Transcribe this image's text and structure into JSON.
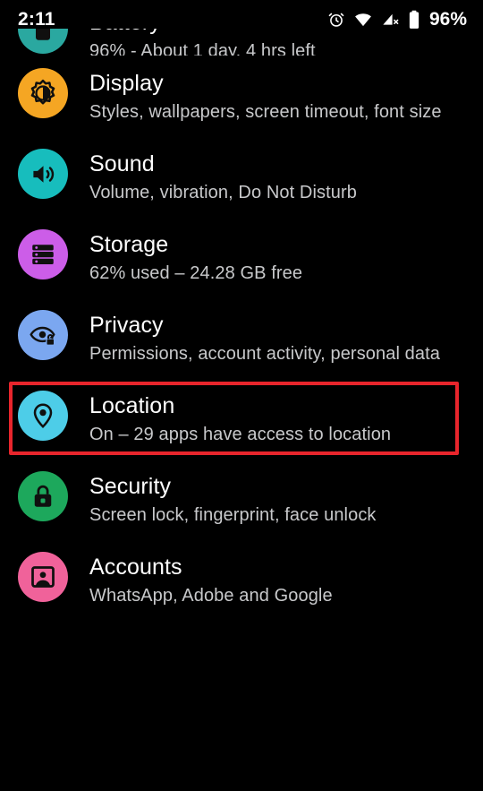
{
  "statusbar": {
    "time": "2:11",
    "battery_percent": "96%",
    "icons": [
      {
        "name": "alarm-icon",
        "label": "alarm"
      },
      {
        "name": "wifi-icon",
        "label": "wifi"
      },
      {
        "name": "mobile-signal-off-icon",
        "label": "no mobile signal"
      },
      {
        "name": "battery-icon",
        "label": "battery"
      }
    ]
  },
  "colors": {
    "background": "#000000",
    "title_text": "#ffffff",
    "summary_text": "#c8c9cb",
    "highlight_border": "#e8252c",
    "battery_icon_bg": "#2aa8a0",
    "display_icon_bg": "#f5a623",
    "sound_icon_bg": "#17bdbd",
    "storage_icon_bg": "#cc5de8",
    "privacy_icon_bg": "#7ba7f0",
    "location_icon_bg": "#4dcde8",
    "security_icon_bg": "#1da85c",
    "accounts_icon_bg": "#f0629a",
    "icon_glyph": "#10100f"
  },
  "settings": {
    "items": [
      {
        "key": "battery",
        "title": "Battery",
        "summary": "96% - About 1 day, 4 hrs left",
        "icon": "battery-circle-icon",
        "clipped": true,
        "highlighted": false
      },
      {
        "key": "display",
        "title": "Display",
        "summary": "Styles, wallpapers, screen timeout, font size",
        "icon": "brightness-icon",
        "clipped": false,
        "highlighted": false
      },
      {
        "key": "sound",
        "title": "Sound",
        "summary": "Volume, vibration, Do Not Disturb",
        "icon": "speaker-icon",
        "clipped": false,
        "highlighted": false
      },
      {
        "key": "storage",
        "title": "Storage",
        "summary": "62% used – 24.28 GB free",
        "icon": "storage-stack-icon",
        "clipped": false,
        "highlighted": false
      },
      {
        "key": "privacy",
        "title": "Privacy",
        "summary": "Permissions, account activity, personal data",
        "icon": "eye-lock-icon",
        "clipped": false,
        "highlighted": false
      },
      {
        "key": "location",
        "title": "Location",
        "summary": "On – 29 apps have access to location",
        "icon": "location-pin-icon",
        "clipped": false,
        "highlighted": true
      },
      {
        "key": "security",
        "title": "Security",
        "summary": "Screen lock, fingerprint, face unlock",
        "icon": "padlock-icon",
        "clipped": false,
        "highlighted": false
      },
      {
        "key": "accounts",
        "title": "Accounts",
        "summary": "WhatsApp, Adobe and Google",
        "icon": "contact-card-icon",
        "clipped": false,
        "highlighted": false
      }
    ]
  }
}
